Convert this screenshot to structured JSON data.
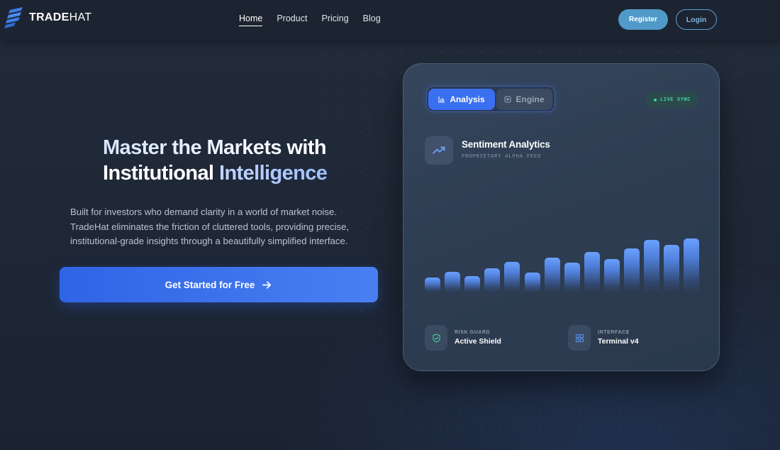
{
  "brand": {
    "name_bold": "TRADE",
    "name_light": "HAT",
    "accent_color": "#3a6ff0"
  },
  "nav": {
    "items": [
      {
        "label": "Home",
        "active": true
      },
      {
        "label": "Product",
        "active": false
      },
      {
        "label": "Pricing",
        "active": false
      },
      {
        "label": "Blog",
        "active": false
      }
    ],
    "register_label": "Register",
    "login_label": "Login"
  },
  "hero": {
    "title_line1": "Master the Markets with",
    "title_line2_plain": "Institutional ",
    "title_line2_accent": "Intelligence",
    "subtitle_lines": [
      "Built for investors who demand clarity in a world of market noise.",
      "TradeHat eliminates the friction of cluttered tools, providing precise,",
      "institutional-grade insights through a beautifully simplified interface."
    ],
    "cta_label": "Get Started for Free",
    "cta_icon": "arrow-right-icon"
  },
  "card": {
    "tabs": [
      {
        "label": "Analysis",
        "icon": "bar-chart-icon",
        "active": true
      },
      {
        "label": "Engine",
        "icon": "square-icon",
        "active": false
      }
    ],
    "live_badge": "LIVE SYNC",
    "live_color": "#3fd39a",
    "feed_title": "Sentiment Analytics",
    "feed_subtitle": "PROPRIETARY ALPHA FEED",
    "feed_icon": "trending-up-icon",
    "bar_levels": [
      0.28,
      0.38,
      0.3,
      0.45,
      0.57,
      0.37,
      0.65,
      0.55,
      0.75,
      0.62,
      0.82,
      0.97,
      0.88,
      1.0
    ],
    "features": [
      {
        "label": "RISK GUARD",
        "value": "Active Shield",
        "icon": "shield-check-icon"
      },
      {
        "label": "INTERFACE",
        "value": "Terminal v4",
        "icon": "grid-icon"
      }
    ]
  }
}
